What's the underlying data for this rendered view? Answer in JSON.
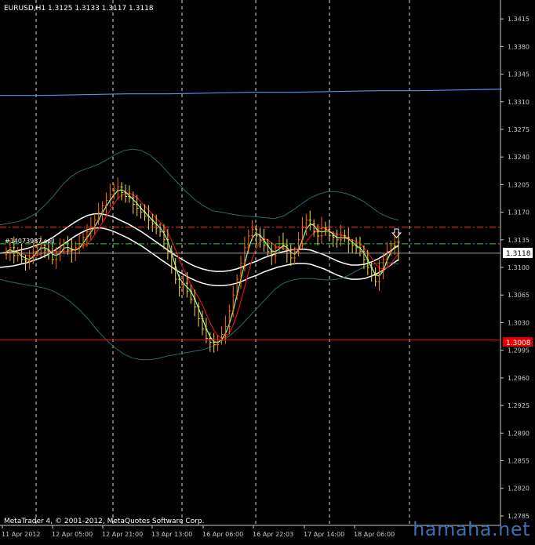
{
  "header": {
    "symbol_text": "EURUSD,H1  1.3125 1.3133 1.3117 1.3118"
  },
  "footer": {
    "copyright": "MetaTrader 4, © 2001-2012, MetaQuotes Software Corp."
  },
  "watermark": "hamaha.net",
  "order_label": "#14073987 sell",
  "current_price_label": "1.3118",
  "red_level_label": "1.3008",
  "colors": {
    "background": "#000000",
    "grid": "#ffffff",
    "axis_text": "#c8c8c8",
    "bull_bar": "#ff6a00",
    "bear_bar": "#ffd84a",
    "ma_red": "#e01010",
    "ma_green": "#9cff9c",
    "envelope_white": "#ffffff",
    "bollinger": "#2f6b63",
    "blue_line": "#4f93ff",
    "red_hline": "#ff0000",
    "red_dash": "#ff3030",
    "green_dash": "#35d035",
    "price_line": "#a0a0a0"
  },
  "chart_data": {
    "type": "candlestick",
    "symbol": "EURUSD",
    "timeframe": "H1",
    "ylim": [
      1.2775,
      1.3435
    ],
    "y_ticks": [
      "1.3415",
      "1.3380",
      "1.3345",
      "1.3310",
      "1.3275",
      "1.3240",
      "1.3205",
      "1.3170",
      "1.3135",
      "1.3100",
      "1.3065",
      "1.3030",
      "1.2995",
      "1.2960",
      "1.2925",
      "1.2890",
      "1.2855",
      "1.2820",
      "1.2785"
    ],
    "x_ticks": [
      "11 Apr 2012",
      "12 Apr 05:00",
      "12 Apr 21:00",
      "13 Apr 13:00",
      "16 Apr 06:00",
      "16 Apr 22:03",
      "17 Apr 14:00",
      "18 Apr 06:00"
    ],
    "closes": [
      1.312,
      1.3125,
      1.3115,
      1.3118,
      1.311,
      1.3108,
      1.3112,
      1.312,
      1.3125,
      1.3128,
      1.3122,
      1.3118,
      1.311,
      1.3118,
      1.3125,
      1.313,
      1.3122,
      1.3118,
      1.3125,
      1.313,
      1.3138,
      1.3145,
      1.315,
      1.316,
      1.317,
      1.3178,
      1.3185,
      1.3192,
      1.3198,
      1.3202,
      1.3195,
      1.319,
      1.3188,
      1.318,
      1.3175,
      1.317,
      1.3165,
      1.316,
      1.3155,
      1.315,
      1.3145,
      1.3135,
      1.312,
      1.31,
      1.3085,
      1.3075,
      1.308,
      1.307,
      1.306,
      1.305,
      1.3035,
      1.3022,
      1.301,
      1.3005,
      1.3002,
      1.3008,
      1.3015,
      1.3025,
      1.3045,
      1.3065,
      1.3085,
      1.3105,
      1.3125,
      1.314,
      1.3148,
      1.314,
      1.3135,
      1.3128,
      1.312,
      1.3115,
      1.3125,
      1.313,
      1.3128,
      1.3118,
      1.3112,
      1.312,
      1.3135,
      1.315,
      1.316,
      1.3155,
      1.3145,
      1.314,
      1.315,
      1.3148,
      1.314,
      1.3138,
      1.3135,
      1.314,
      1.3138,
      1.313,
      1.3128,
      1.3125,
      1.312,
      1.311,
      1.31,
      1.309,
      1.3082,
      1.3095,
      1.311,
      1.312,
      1.3128,
      1.3132,
      1.3118
    ],
    "series": [
      {
        "name": "",
        "values": [
          1.31,
          1.3101,
          1.3102,
          1.3104,
          1.3106,
          1.3109,
          1.3112,
          1.3116,
          1.3121,
          1.3127,
          1.3133,
          1.3139,
          1.3144,
          1.3148,
          1.315,
          1.315,
          1.3148,
          1.3145,
          1.3141,
          1.3137,
          1.3132,
          1.3127,
          1.3121,
          1.3115,
          1.3109,
          1.3103,
          1.3097,
          1.3092,
          1.3087,
          1.3083,
          1.308,
          1.3078,
          1.3077,
          1.3077,
          1.3078,
          1.308,
          1.3083,
          1.3087,
          1.309,
          1.3094,
          1.3097,
          1.31,
          1.3102,
          1.3104,
          1.3105,
          1.3105,
          1.3104,
          1.3101,
          1.3098,
          1.3094,
          1.309,
          1.3087,
          1.3085,
          1.3085,
          1.3086,
          1.3089,
          1.3093,
          1.3098,
          1.3104,
          1.311
        ]
      },
      {
        "name": "",
        "values": [
          1.3118,
          1.3119,
          1.312,
          1.3122,
          1.3124,
          1.3127,
          1.313,
          1.3134,
          1.3139,
          1.3145,
          1.3151,
          1.3157,
          1.3162,
          1.3166,
          1.3168,
          1.3168,
          1.3166,
          1.3163,
          1.3159,
          1.3155,
          1.315,
          1.3145,
          1.3139,
          1.3133,
          1.3127,
          1.3121,
          1.3115,
          1.311,
          1.3105,
          1.3101,
          1.3098,
          1.3096,
          1.3095,
          1.3095,
          1.3096,
          1.3098,
          1.3101,
          1.3105,
          1.3108,
          1.3112,
          1.3115,
          1.3118,
          1.312,
          1.3122,
          1.3123,
          1.3123,
          1.3122,
          1.3119,
          1.3116,
          1.3112,
          1.3108,
          1.3105,
          1.3103,
          1.3103,
          1.3104,
          1.3107,
          1.3111,
          1.3116,
          1.3122,
          1.3128
        ]
      },
      {
        "name": "",
        "values": [
          1.3154,
          1.3156,
          1.3158,
          1.3162,
          1.3168,
          1.3178,
          1.319,
          1.3204,
          1.3215,
          1.3222,
          1.3226,
          1.323,
          1.3236,
          1.3243,
          1.3248,
          1.325,
          1.3248,
          1.3242,
          1.3232,
          1.322,
          1.3208,
          1.3196,
          1.3186,
          1.3178,
          1.3172,
          1.317,
          1.3168,
          1.3166,
          1.3165,
          1.3164,
          1.3163,
          1.3162,
          1.3165,
          1.3172,
          1.318,
          1.3188,
          1.3193,
          1.3196,
          1.3196,
          1.3194,
          1.319,
          1.3184,
          1.3176,
          1.3168,
          1.3163,
          1.316
        ]
      },
      {
        "name": "",
        "values": [
          1.3085,
          1.3082,
          1.308,
          1.3078,
          1.3076,
          1.3074,
          1.307,
          1.3064,
          1.3056,
          1.3046,
          1.3034,
          1.302,
          1.3008,
          1.2998,
          1.299,
          1.2985,
          1.2983,
          1.2983,
          1.2985,
          1.2988,
          1.299,
          1.2992,
          1.2994,
          1.2996,
          1.3,
          1.3006,
          1.3014,
          1.3024,
          1.3036,
          1.3048,
          1.306,
          1.3072,
          1.308,
          1.3084,
          1.3086,
          1.3086,
          1.3085,
          1.3084,
          1.3085,
          1.3088,
          1.3094,
          1.31,
          1.3104,
          1.3106,
          1.3106,
          1.3104
        ]
      },
      {
        "name": "",
        "values": [
          1.3318,
          1.3318,
          1.3319,
          1.332,
          1.332,
          1.3321,
          1.3322,
          1.3322,
          1.3323,
          1.3324,
          1.3324,
          1.3325,
          1.3326
        ]
      }
    ],
    "hlines": [
      {
        "value": 1.3118,
        "style": "solid",
        "label": "1.3118"
      },
      {
        "value": 1.3008,
        "style": "solid",
        "label": "1.3008"
      },
      {
        "value": 1.3151,
        "style": "dash-dot"
      },
      {
        "value": 1.313,
        "style": "dash-dot"
      }
    ],
    "grid": true
  }
}
